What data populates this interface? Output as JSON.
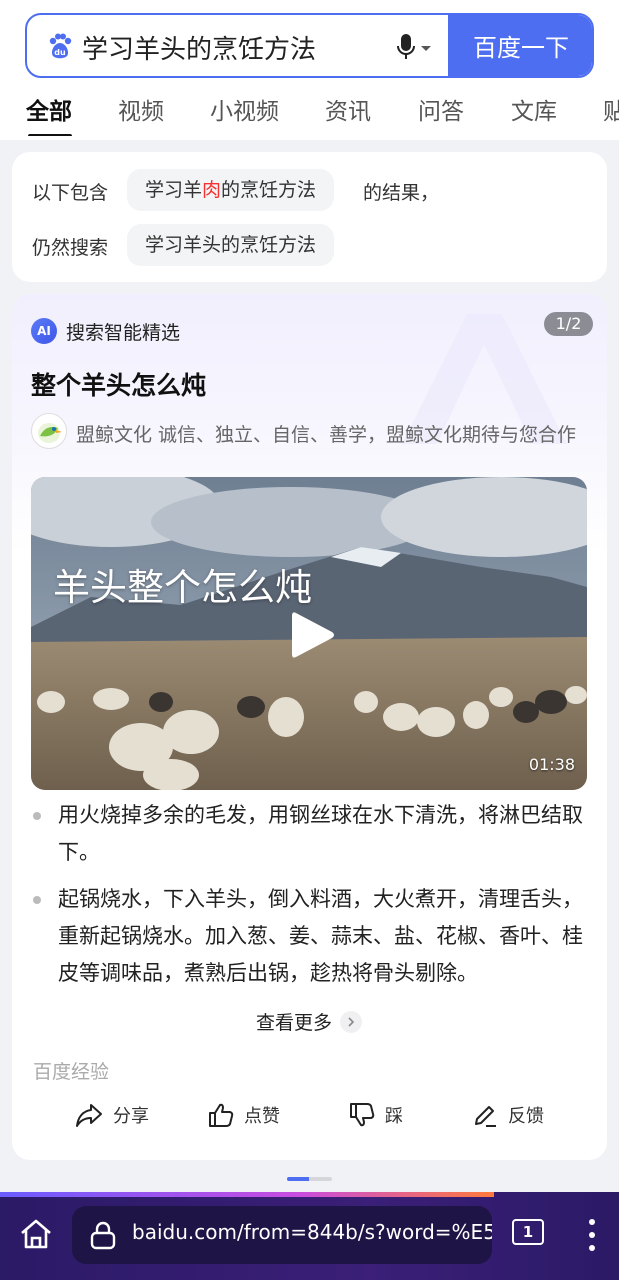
{
  "search": {
    "query": "学习羊头的烹饪方法",
    "button_label": "百度一下"
  },
  "tabs": [
    "全部",
    "视频",
    "小视频",
    "资讯",
    "问答",
    "文库",
    "贴"
  ],
  "did_you_mean": {
    "prefix": "以下包含",
    "corrected_a": "学习羊",
    "corrected_hl": "肉",
    "corrected_b": "的烹饪方法",
    "suffix": "的结果，",
    "still_label": "仍然搜索",
    "original": "学习羊头的烹饪方法"
  },
  "ai_card": {
    "label": "搜索智能精选",
    "logo_text": "AI",
    "pager": "1/2",
    "question": "整个羊头怎么炖",
    "source_text": "盟鲸文化 诚信、独立、自信、善学，盟鲸文化期待与您合作",
    "video_title": "羊头整个怎么炖",
    "video_duration": "01:38",
    "bullets": [
      "用火烧掉多余的毛发，用钢丝球在水下清洗，将淋巴结取下。",
      "起锅烧水，下入羊头，倒入料酒，大火煮开，清理舌头，重新起锅烧水。加入葱、姜、蒜末、盐、花椒、香叶、桂皮等调味品，煮熟后出锅，趁热将骨头剔除。"
    ],
    "more_label": "查看更多",
    "brand": "百度经验",
    "actions": {
      "share": "分享",
      "like": "点赞",
      "dislike": "踩",
      "feedback": "反馈"
    }
  },
  "browser": {
    "url": "baidu.com/from=844b/s?word=%E5",
    "tab_count": "1"
  }
}
